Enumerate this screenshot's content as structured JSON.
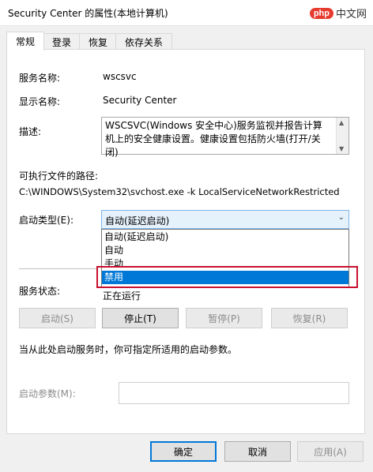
{
  "window": {
    "title": "Security Center 的属性(本地计算机)",
    "watermark_logo": "php",
    "watermark_text": "中文网"
  },
  "tabs": [
    {
      "label": "常规",
      "active": true
    },
    {
      "label": "登录",
      "active": false
    },
    {
      "label": "恢复",
      "active": false
    },
    {
      "label": "依存关系",
      "active": false
    }
  ],
  "general": {
    "service_name_label": "服务名称:",
    "service_name_value": "wscsvc",
    "display_name_label": "显示名称:",
    "display_name_value": "Security Center",
    "description_label": "描述:",
    "description_value": "WSCSVC(Windows 安全中心)服务监视并报告计算机上的安全健康设置。健康设置包括防火墙(打开/关闭)",
    "exe_path_label": "可执行文件的路径:",
    "exe_path_value": "C:\\WINDOWS\\System32\\svchost.exe -k LocalServiceNetworkRestricted",
    "startup_type_label": "启动类型(E):",
    "startup_type_value": "自动(延迟启动)",
    "startup_options": [
      "自动(延迟启动)",
      "自动",
      "手动",
      "禁用"
    ],
    "highlighted_option": "禁用",
    "service_status_label": "服务状态:",
    "service_status_value": "正在运行",
    "start_button": "启动(S)",
    "stop_button": "停止(T)",
    "pause_button": "暂停(P)",
    "resume_button": "恢复(R)",
    "hint": "当从此处启动服务时，你可指定所适用的启动参数。",
    "start_params_label": "启动参数(M):",
    "start_params_value": ""
  },
  "footer": {
    "ok_button": "确定",
    "cancel_button": "取消",
    "apply_button": "应用(A)"
  },
  "colors": {
    "selection": "#0078d7",
    "highlight_box": "#c8102e"
  }
}
